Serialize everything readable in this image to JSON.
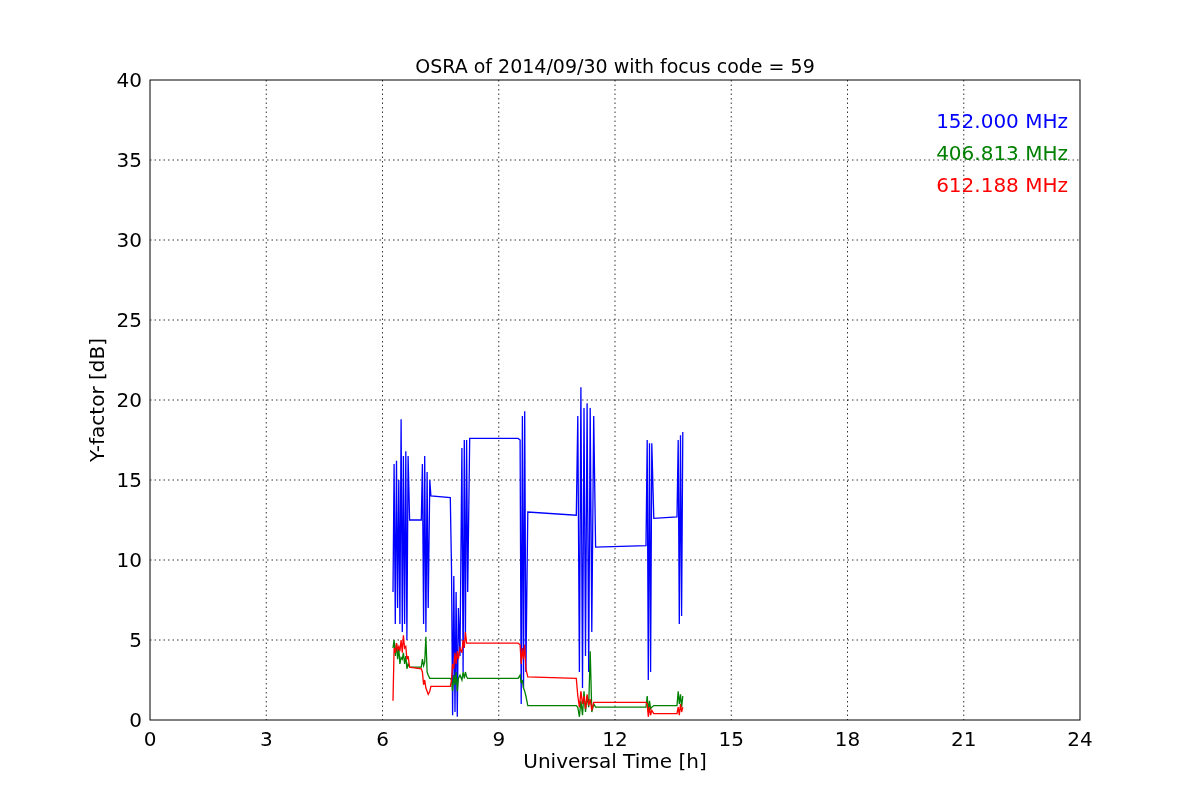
{
  "chart_data": {
    "type": "line",
    "grid": true,
    "title": "OSRA of 2014/09/30 with focus code = 59",
    "xlabel": "Universal Time [h]",
    "ylabel": "Y-factor [dB]",
    "xlim": [
      0,
      24
    ],
    "ylim": [
      0,
      40
    ],
    "xticks": [
      0,
      3,
      6,
      9,
      12,
      15,
      18,
      21,
      24
    ],
    "yticks": [
      0,
      5,
      10,
      15,
      20,
      25,
      30,
      35,
      40
    ],
    "x": [
      6.27,
      6.3,
      6.33,
      6.36,
      6.39,
      6.42,
      6.45,
      6.48,
      6.51,
      6.54,
      6.57,
      6.6,
      6.63,
      6.66,
      6.7,
      7.0,
      7.03,
      7.06,
      7.09,
      7.12,
      7.15,
      7.18,
      7.22,
      7.25,
      7.75,
      7.78,
      7.81,
      7.84,
      7.87,
      7.9,
      7.93,
      7.96,
      8.0,
      8.05,
      8.08,
      8.11,
      8.14,
      8.17,
      8.2,
      8.25,
      9.5,
      9.55,
      9.58,
      9.61,
      9.64,
      9.67,
      9.7,
      9.75,
      11.0,
      11.04,
      11.08,
      11.12,
      11.16,
      11.2,
      11.24,
      11.28,
      11.32,
      11.36,
      11.4,
      11.45,
      11.5,
      12.8,
      12.83,
      12.86,
      12.89,
      12.92,
      12.95,
      13.0,
      13.6,
      13.63,
      13.66,
      13.69,
      13.72,
      13.75
    ],
    "series": [
      {
        "name": "152.000 MHz",
        "color": "#0000ff",
        "values": [
          8,
          16,
          6,
          16.2,
          7,
          15,
          6,
          18.8,
          5.5,
          16.5,
          6,
          16.8,
          5,
          16.5,
          12.5,
          12.5,
          16,
          6,
          16.5,
          5.5,
          15.5,
          7,
          15,
          14,
          13.9,
          9.5,
          0.3,
          9,
          0.5,
          8,
          0.2,
          7,
          4,
          17,
          3,
          17.5,
          5,
          17.5,
          8,
          17.6,
          17.6,
          17.5,
          1,
          19,
          2,
          19.3,
          3,
          13,
          12.8,
          19,
          3,
          20.8,
          2,
          19.5,
          4,
          19.8,
          3,
          19.5,
          5.5,
          19,
          10.8,
          10.9,
          17.5,
          2.5,
          17.3,
          3,
          17.3,
          12.6,
          12.7,
          17.5,
          6,
          17.8,
          6.5,
          18
        ]
      },
      {
        "name": "406.813 MHz",
        "color": "#008000",
        "values": [
          4.5,
          5,
          4,
          4.8,
          3.8,
          4.5,
          3.5,
          3.9,
          3.8,
          4.2,
          3.5,
          4,
          3.2,
          3.5,
          3.3,
          3.3,
          3.8,
          3.4,
          3.6,
          5.2,
          3.0,
          2.8,
          2.6,
          2.6,
          2.6,
          2.5,
          1.8,
          2.8,
          2.2,
          3,
          1.8,
          2.6,
          2.8,
          2.5,
          3,
          2.6,
          3,
          2.7,
          2.6,
          2.6,
          2.6,
          2.8,
          2.3,
          2.5,
          2,
          1.8,
          1.5,
          0.9,
          0.9,
          0.8,
          0.2,
          1.2,
          0.3,
          1.8,
          0.5,
          1.5,
          0.8,
          4.3,
          0.5,
          1,
          0.8,
          0.8,
          1.5,
          0.5,
          1.2,
          0.7,
          0.8,
          0.9,
          0.9,
          1.8,
          1,
          1.6,
          0.8,
          1.5
        ]
      },
      {
        "name": "612.188 MHz",
        "color": "#ff0000",
        "values": [
          1.2,
          4.5,
          4.2,
          4.8,
          4.4,
          4.6,
          4.3,
          5,
          4.2,
          5.3,
          4.5,
          4.6,
          3.8,
          4,
          3.3,
          3.2,
          3,
          2.2,
          2.5,
          2,
          1.8,
          1.6,
          1.8,
          2.1,
          2.1,
          2.5,
          3.5,
          3.2,
          4.2,
          3.5,
          4.3,
          3.8,
          4.5,
          4.2,
          5,
          4.5,
          5.5,
          4.8,
          4.8,
          4.8,
          4.8,
          4.7,
          3.5,
          4.5,
          3.8,
          4.7,
          3.2,
          2.7,
          2.6,
          1.5,
          0.8,
          1.8,
          1,
          1.5,
          0.7,
          1.6,
          0.9,
          1.3,
          0.6,
          1.1,
          1.1,
          1.1,
          1,
          0.2,
          0.8,
          0.3,
          0.6,
          0.4,
          0.4,
          0.8,
          0.3,
          1,
          0.5,
          0.8
        ]
      }
    ]
  }
}
